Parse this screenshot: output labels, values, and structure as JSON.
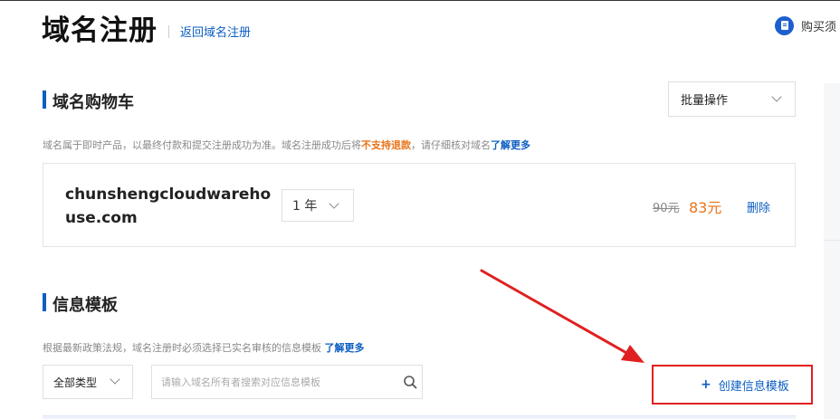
{
  "header": {
    "title": "域名注册",
    "back_link": "返回域名注册",
    "buy_notice": "购买须"
  },
  "cart": {
    "section_title": "域名购物车",
    "batch_action": "批量操作",
    "notice_prefix": "域名属于即时产品，以最终付款和提交注册成功为准。域名注册成功后将",
    "notice_warning": "不支持退款",
    "notice_suffix": "，请仔细核对域名",
    "notice_link": "了解更多",
    "item": {
      "domain": "chunshengcloudwarehouse.com",
      "period": "1 年",
      "original_price": "90元",
      "price": "83元",
      "delete": "删除"
    }
  },
  "template": {
    "section_title": "信息模板",
    "notice_text": "根据最新政策法规，域名注册时必须选择已实名审核的信息模板",
    "notice_link": "了解更多",
    "type_filter": "全部类型",
    "search_placeholder": "请输入域名所有者搜索对应信息模板",
    "create_button": "创建信息模板"
  },
  "colors": {
    "accent": "#0c5ec2",
    "price": "#e8741a",
    "highlight_box": "#e02020",
    "arrow": "#e02020"
  }
}
